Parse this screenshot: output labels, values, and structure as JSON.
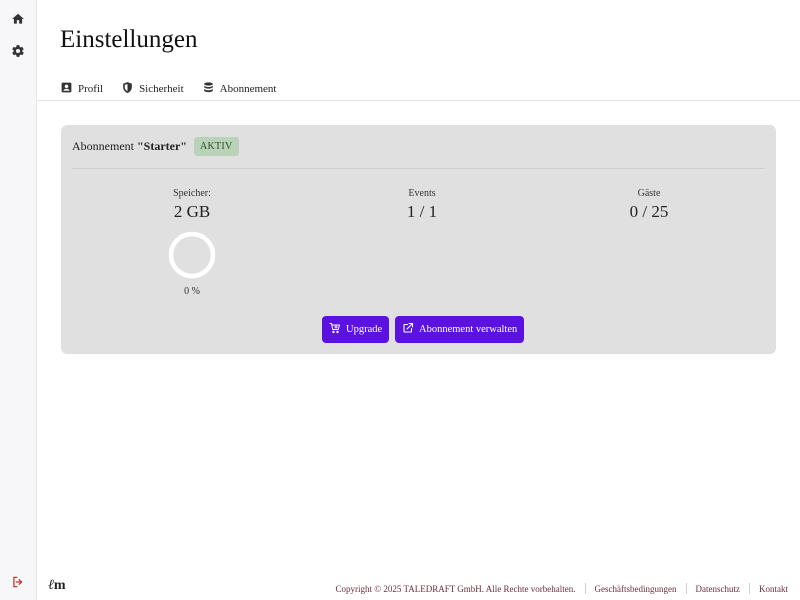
{
  "page": {
    "title": "Einstellungen"
  },
  "sidebar": {
    "top": [
      {
        "name": "home-icon"
      },
      {
        "name": "gear-icon"
      }
    ],
    "bottom": {
      "name": "logout-icon",
      "color": "#c0392b"
    }
  },
  "tabs": [
    {
      "label": "Profil",
      "icon": "profile-icon"
    },
    {
      "label": "Sicherheit",
      "icon": "shield-icon"
    },
    {
      "label": "Abonnement",
      "icon": "database-icon"
    }
  ],
  "subscription": {
    "prefix": "Abonnement ",
    "plan": "\"Starter\"",
    "status": "AKTIV",
    "stats": [
      {
        "label": "Speicher:",
        "value": "2 GB",
        "percent": "0 %",
        "usage_fraction": 0
      },
      {
        "label": "Events",
        "value": "1 / 1"
      },
      {
        "label": "Gäste",
        "value": "0 / 25"
      }
    ],
    "buttons": {
      "upgrade": "Upgrade",
      "manage": "Abonnement verwalten"
    }
  },
  "footer": {
    "logo_first": "ℓ",
    "logo_second": "m",
    "copyright": "Copyright © 2025 TALEDRAFT GmbH. Alle Rechte vorbehalten.",
    "links": [
      "Geschäftsbedingungen",
      "Datenschutz",
      "Kontakt"
    ]
  },
  "colors": {
    "accent": "#5b12e0",
    "badge_bg": "#b8d3b8",
    "card_bg": "#e0e0e0",
    "logout": "#c0392b",
    "footer_text": "#6b2d3d"
  }
}
